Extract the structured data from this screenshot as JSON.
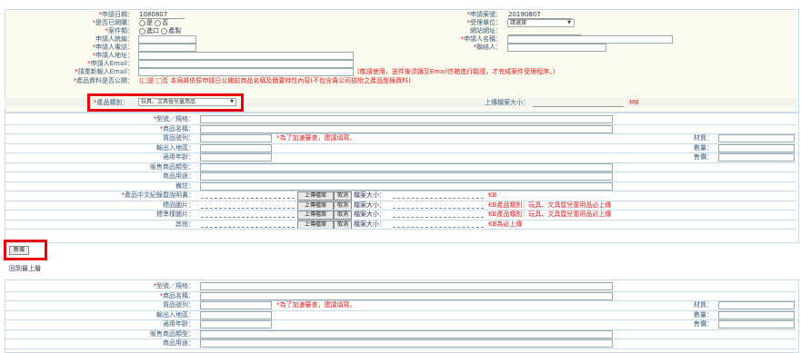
{
  "top": {
    "apply_date": {
      "label": "申請日期：",
      "value": "1080807"
    },
    "registered": {
      "label": "是否已網購：",
      "opt1": "是",
      "opt2": "否"
    },
    "case_type": {
      "label": "案件類：",
      "opt1": "進口",
      "opt2": "產製"
    },
    "applicant_id": {
      "label": "申請人統編："
    },
    "applicant_phone": {
      "label": "申請人電話："
    },
    "applicant_addr": {
      "label": "申請人地址："
    },
    "applicant_email": {
      "label": "申請人Email："
    },
    "reenter_email": {
      "label": "請重新輸入Email：",
      "note": "(敬請使用，送件後須讀至Email信箱進行驗證，才完成案件受理程序。)"
    },
    "product_info": {
      "label": "產品資料是否公開：",
      "note": "(□是 □否 本局將依原申請日公開前商品名稱及簡要特性內容(不包含貴公司檢附之產品型錄資料)"
    },
    "product_category": {
      "label": "產品類別：",
      "value": "玩具、文具暨兒童用品"
    },
    "apply_no": {
      "label": "申請案號：",
      "value": "20190807"
    },
    "unit": {
      "label": "受理單位：",
      "value": "請選擇"
    },
    "site": {
      "label": "網站網址："
    },
    "applicant_name": {
      "label": "申請人名稱："
    },
    "contact": {
      "label": "聯絡人："
    },
    "upload_size": {
      "label": "上傳檔案大小：",
      "unit": "MB"
    }
  },
  "product_block": {
    "model": "型號／規格：",
    "name": "商品名稱：",
    "category": "貨品號列：",
    "category_note": "*為了加速審查，建議填寫。",
    "origin": "輸出入地區：",
    "age": "適用年齡：",
    "type": "販售商品類型：",
    "usage": "商品用途：",
    "remark": "備註：",
    "material": "材質：",
    "quantity": "數量：",
    "price": "售價：",
    "manual": "產品中文紀錄暨說明書：",
    "label_img": "標品圖片：",
    "std_img": "標準樣圖片：",
    "other": "其他：",
    "upload_btn": "上傳檔案",
    "cancel_btn": "取消",
    "size_label": "檔案大小：",
    "kb": "KB",
    "kb_note1": "KB產品類別：玩具、文具暨兒童用品必上傳",
    "kb_note2": "KB產品類別：玩具、文具暨兒童用品必上傳",
    "kb_note3": "KB為必上傳"
  },
  "add_button": "新增",
  "back_top": "回到最上層",
  "colors": {
    "label": "#3a5a7a",
    "required": "#e02020",
    "highlight_box": "#e8000b",
    "header_bg": "#fffde6"
  }
}
